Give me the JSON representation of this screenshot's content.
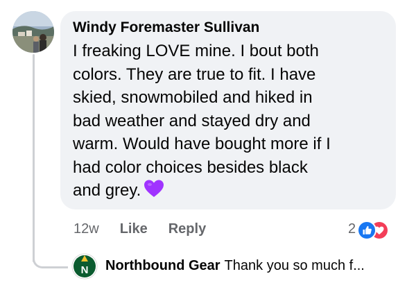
{
  "comment": {
    "author": "Windy Foremaster Sullivan",
    "text_lines": [
      "I freaking LOVE mine. I bout both",
      "colors. They are true to fit. I have",
      "skied, snowmobiled and hiked in",
      "bad weather and stayed dry and",
      "warm. Would have bought more if I",
      "had color choices besides black",
      "and grey."
    ],
    "emoji": "purple-heart-icon",
    "timestamp": "12w",
    "like_label": "Like",
    "reply_label": "Reply",
    "reaction_count": "2",
    "reactions": [
      "like-icon",
      "love-icon"
    ]
  },
  "reply": {
    "author": "Northbound Gear",
    "text_preview": "Thank you so much f...",
    "avatar_letter": "N"
  },
  "colors": {
    "bubble_bg": "#f0f2f5",
    "meta_text": "#65676b",
    "like_blue": "#1877f2",
    "love_red": "#f33e58",
    "heart_purple": "#a033ff",
    "brand_green": "#0b5b2f"
  }
}
